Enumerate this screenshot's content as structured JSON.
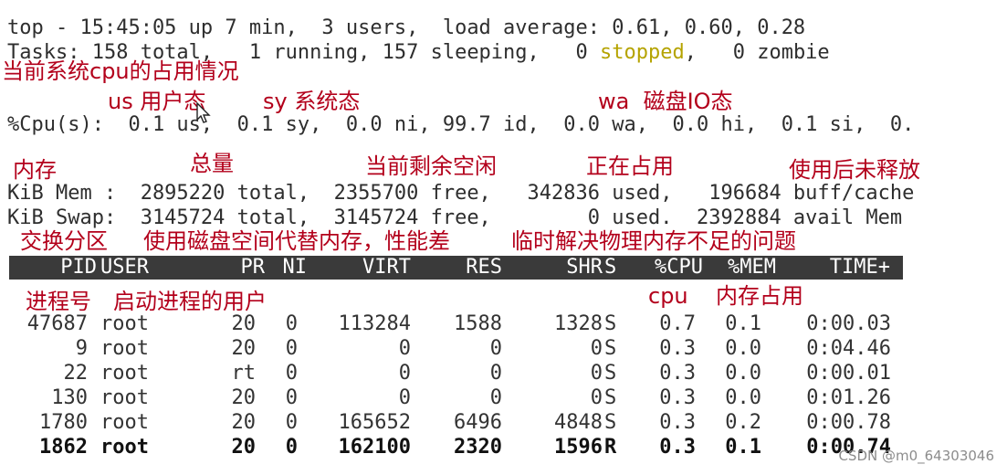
{
  "summary": {
    "top_line": "top - 15:45:05 up 7 min,  3 users,  load average: 0.61, 0.60, 0.28",
    "tasks_prefix": "Tasks: 158 total,   1 running, 157 sleeping,   0 ",
    "tasks_stopped": "stopped",
    "tasks_suffix": ",   0 zombie",
    "cpu_line": "%Cpu(s):  0.1 us,  0.1 sy,  0.0 ni, 99.7 id,  0.0 wa,  0.0 hi,  0.1 si,  0.",
    "mem_line": "KiB Mem :  2895220 total,  2355700 free,   342836 used,   196684 buff/cache",
    "swap_line": "KiB Swap:  3145724 total,  3145724 free,        0 used.  2392884 avail Mem"
  },
  "annotations": {
    "cpu_title": "当前系统cpu的占用情况",
    "us": "us 用户态",
    "sy": "sy 系统态",
    "wa": "wa  磁盘IO态",
    "mem": "内存",
    "total": "总量",
    "free": "当前剩余空闲",
    "used": "正在占用",
    "cache": "使用后未释放",
    "swap": "交换分区",
    "swap_desc": "使用磁盘空间代替内存，性能差",
    "swap_desc2": "临时解决物理内存不足的问题",
    "pid": "进程号",
    "user": "启动进程的用户",
    "cpu": "cpu",
    "memuse": "内存占用"
  },
  "columns": [
    "PID",
    "USER",
    "PR",
    "NI",
    "VIRT",
    "RES",
    "SHR",
    "S",
    "%CPU",
    "%MEM",
    "TIME+"
  ],
  "processes": [
    {
      "pid": "47687",
      "user": "root",
      "pr": "20",
      "ni": "0",
      "virt": "113284",
      "res": "1588",
      "shr": "1328",
      "s": "S",
      "cpu": "0.7",
      "mem": "0.1",
      "time": "0:00.03"
    },
    {
      "pid": "9",
      "user": "root",
      "pr": "20",
      "ni": "0",
      "virt": "0",
      "res": "0",
      "shr": "0",
      "s": "S",
      "cpu": "0.3",
      "mem": "0.0",
      "time": "0:04.46"
    },
    {
      "pid": "22",
      "user": "root",
      "pr": "rt",
      "ni": "0",
      "virt": "0",
      "res": "0",
      "shr": "0",
      "s": "S",
      "cpu": "0.3",
      "mem": "0.0",
      "time": "0:00.01"
    },
    {
      "pid": "130",
      "user": "root",
      "pr": "20",
      "ni": "0",
      "virt": "0",
      "res": "0",
      "shr": "0",
      "s": "S",
      "cpu": "0.3",
      "mem": "0.0",
      "time": "0:01.26"
    },
    {
      "pid": "1780",
      "user": "root",
      "pr": "20",
      "ni": "0",
      "virt": "165652",
      "res": "6496",
      "shr": "4848",
      "s": "S",
      "cpu": "0.3",
      "mem": "0.2",
      "time": "0:00.78"
    },
    {
      "pid": "1862",
      "user": "root",
      "pr": "20",
      "ni": "0",
      "virt": "162100",
      "res": "2320",
      "shr": "1596",
      "s": "R",
      "cpu": "0.3",
      "mem": "0.1",
      "time": "0:00.74"
    }
  ],
  "watermark": "CSDN @m0_64303046",
  "colors": {
    "annotation": "#b3001b",
    "stopped": "#b5a300",
    "header_bg": "#3a3a3a"
  }
}
